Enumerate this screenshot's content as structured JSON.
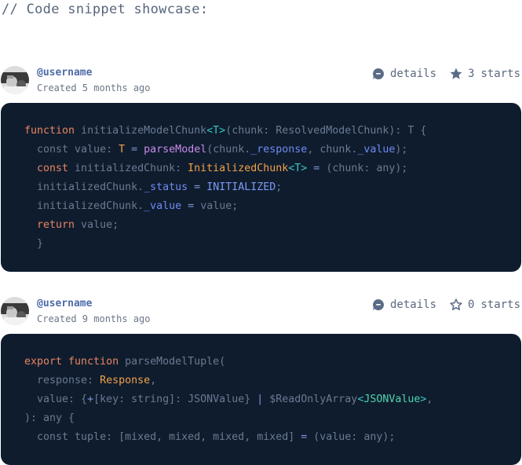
{
  "heading": "// Code snippet showcase:",
  "snippets": [
    {
      "username": "@username",
      "created": "Created 5 months ago",
      "details_label": "details",
      "stars_count": "3",
      "stars_label": "starts",
      "starred": true
    },
    {
      "username": "@username",
      "created": "Created 9 months ago",
      "details_label": "details",
      "stars_count": "0",
      "stars_label": "starts",
      "starred": false
    }
  ],
  "code1": [
    [
      [
        "kw",
        "function "
      ],
      [
        "pl",
        "initializeModelChunk"
      ],
      [
        "gen",
        "<T>"
      ],
      [
        "pl",
        "(chunk: ResolvedModelChunk): T {"
      ]
    ],
    [
      [
        "pl",
        "  const value: "
      ],
      [
        "type",
        "T"
      ],
      [
        "pl",
        " "
      ],
      [
        "op",
        "="
      ],
      [
        "pl",
        " "
      ],
      [
        "fn",
        "parseModel"
      ],
      [
        "pl",
        "(chunk."
      ],
      [
        "prop",
        "_response"
      ],
      [
        "pl",
        ", chunk."
      ],
      [
        "prop",
        "_value"
      ],
      [
        "pl",
        ");"
      ]
    ],
    [
      [
        "kw",
        "  const "
      ],
      [
        "pl",
        "initializedChunk: "
      ],
      [
        "type",
        "InitializedChunk"
      ],
      [
        "gen",
        "<T>"
      ],
      [
        "pl",
        " "
      ],
      [
        "op",
        "="
      ],
      [
        "pl",
        " (chunk: any);"
      ]
    ],
    [
      [
        "pl",
        "  initializedChunk."
      ],
      [
        "prop",
        "_status"
      ],
      [
        "pl",
        " "
      ],
      [
        "op",
        "="
      ],
      [
        "pl",
        " "
      ],
      [
        "const",
        "INITIALIZED"
      ],
      [
        "pl",
        ";"
      ]
    ],
    [
      [
        "pl",
        "  initializedChunk."
      ],
      [
        "prop",
        "_value"
      ],
      [
        "pl",
        " "
      ],
      [
        "op",
        "="
      ],
      [
        "pl",
        " value;"
      ]
    ],
    [
      [
        "ret",
        "  return "
      ],
      [
        "pl",
        "value;"
      ]
    ],
    [
      [
        "pl",
        "  }"
      ]
    ]
  ],
  "code2": [
    [
      [
        "kw",
        "export function "
      ],
      [
        "pl",
        "parseModelTuple("
      ]
    ],
    [
      [
        "pl",
        "  response: "
      ],
      [
        "type",
        "Response"
      ],
      [
        "pl",
        ","
      ]
    ],
    [
      [
        "pl",
        "  value: {"
      ],
      [
        "op",
        "+"
      ],
      [
        "pl",
        "[key: string]: JSONValue} "
      ],
      [
        "op",
        "|"
      ],
      [
        "pl",
        " $ReadOnlyArray"
      ],
      [
        "gen",
        "<"
      ],
      [
        "green",
        "JSONValue"
      ],
      [
        "gen",
        ">"
      ],
      [
        "pl",
        ","
      ]
    ],
    [
      [
        "pl",
        "): any {"
      ]
    ],
    [
      [
        "pl",
        "  const tuple: [mixed, mixed, mixed, mixed] "
      ],
      [
        "op",
        "="
      ],
      [
        "pl",
        " (value: any);"
      ]
    ]
  ],
  "colors": {
    "code_bg": "#0f1c2e",
    "username": "#4d6ba7",
    "icon": "#5a6b86"
  }
}
